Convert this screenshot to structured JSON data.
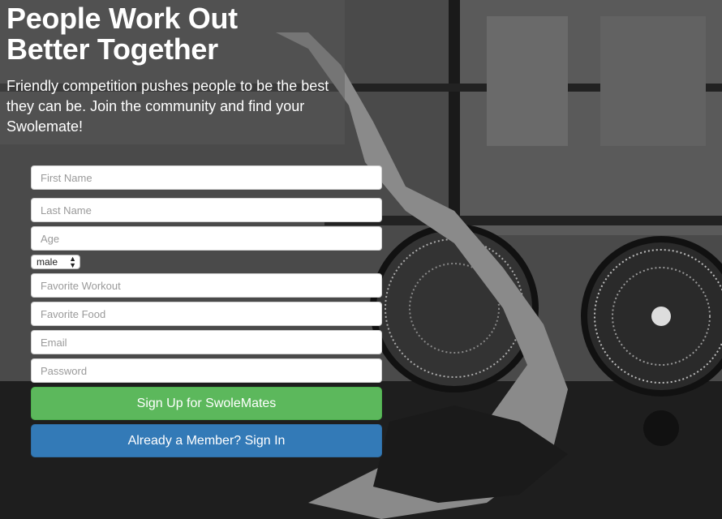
{
  "hero": {
    "headline_line1": "People Work Out",
    "headline_line2": "Better Together",
    "subtext": "Friendly competition pushes people to be the best they can be. Join the community and find your Swolemate!"
  },
  "form": {
    "first_name": {
      "placeholder": "First Name",
      "value": ""
    },
    "last_name": {
      "placeholder": "Last Name",
      "value": ""
    },
    "age": {
      "placeholder": "Age",
      "value": ""
    },
    "gender": {
      "selected": "male"
    },
    "favorite_workout": {
      "placeholder": "Favorite Workout",
      "value": ""
    },
    "favorite_food": {
      "placeholder": "Favorite Food",
      "value": ""
    },
    "email": {
      "placeholder": "Email",
      "value": ""
    },
    "password": {
      "placeholder": "Password",
      "value": ""
    }
  },
  "buttons": {
    "signup_label": "Sign Up for SwoleMates",
    "signin_label": "Already a Member? Sign In"
  },
  "colors": {
    "signup": "#5cb85c",
    "signin": "#337ab7",
    "headline": "#ffffff"
  }
}
